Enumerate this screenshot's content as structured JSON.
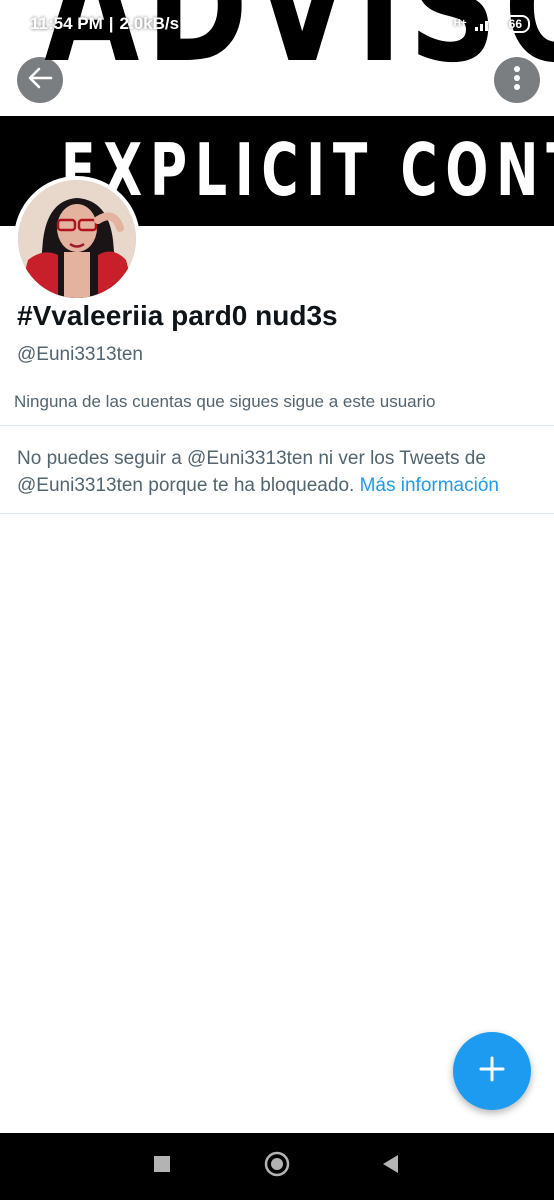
{
  "status_bar": {
    "time": "11:54 PM",
    "speed": "2.0kB/s",
    "network": "H+",
    "battery": "66"
  },
  "header": {
    "banner_top_text": "ADVISORY",
    "banner_bottom_text": "EXPLICIT CONTENT",
    "back_icon": "arrow-left-icon",
    "more_icon": "more-vertical-icon"
  },
  "profile": {
    "display_name": "#Vvaleeriia pard0 nud3s",
    "handle": "@Euni3313ten",
    "followers_note": "Ninguna de las cuentas que sigues sigue a este usuario",
    "blocked_text": "No puedes seguir a @Euni3313ten ni ver los Tweets de @Euni3313ten porque te ha bloqueado.",
    "more_info_link": "Más información"
  },
  "fab": {
    "icon": "plus-icon"
  },
  "nav_bar": {
    "recents_icon": "square-icon",
    "home_icon": "circle-icon",
    "back_icon": "triangle-back-icon"
  },
  "colors": {
    "accent": "#1d9bf0",
    "secondary_text": "#536471",
    "primary_text": "#0f1419"
  }
}
